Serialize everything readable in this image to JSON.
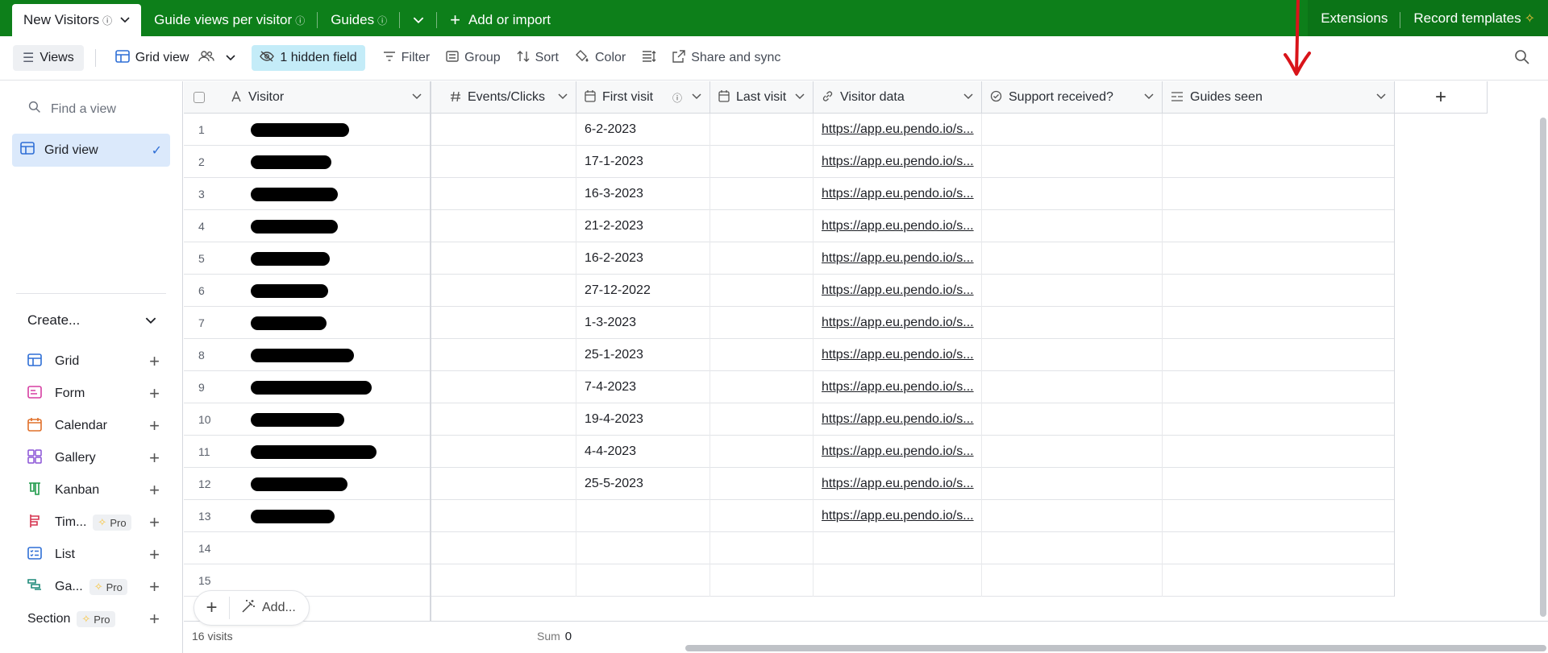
{
  "topbar": {
    "tabs": [
      {
        "label": "New Visitors",
        "active": true
      },
      {
        "label": "Guide views per visitor"
      },
      {
        "label": "Guides"
      }
    ],
    "add_label": "Add or import",
    "extensions_label": "Extensions",
    "record_templates_label": "Record templates"
  },
  "toolbar": {
    "views_label": "Views",
    "grid_view_label": "Grid view",
    "hidden_label": "1 hidden field",
    "filter_label": "Filter",
    "group_label": "Group",
    "sort_label": "Sort",
    "color_label": "Color",
    "share_label": "Share and sync"
  },
  "sidebar": {
    "find_placeholder": "Find a view",
    "active_view": "Grid view",
    "create_label": "Create...",
    "create_items": [
      {
        "label": "Grid",
        "color": "#2f6fd6"
      },
      {
        "label": "Form",
        "color": "#d63ea2"
      },
      {
        "label": "Calendar",
        "color": "#e0702a"
      },
      {
        "label": "Gallery",
        "color": "#8a52d6"
      },
      {
        "label": "Kanban",
        "color": "#1f9a4a"
      },
      {
        "label": "Tim...",
        "color": "#d6334f",
        "pro": "Pro"
      },
      {
        "label": "List",
        "color": "#2f6fd6"
      },
      {
        "label": "Ga...",
        "color": "#1f8a7a",
        "pro": "Pro"
      }
    ],
    "section_label": "Section",
    "section_pro": "Pro"
  },
  "grid": {
    "columns": [
      {
        "label": "Visitor",
        "icon": "text-icon"
      },
      {
        "label": "Events/Clicks",
        "icon": "number-icon"
      },
      {
        "label": "First visit",
        "icon": "calendar-icon"
      },
      {
        "label": "Last visit",
        "icon": "calendar-icon"
      },
      {
        "label": "Visitor data",
        "icon": "link-icon"
      },
      {
        "label": "Support received?",
        "icon": "check-circle-icon"
      },
      {
        "label": "Guides seen",
        "icon": "list-icon"
      }
    ],
    "rows": [
      {
        "n": "1",
        "first": "6-2-2023",
        "url": "https://app.eu.pendo.io/s..."
      },
      {
        "n": "2",
        "first": "17-1-2023",
        "url": "https://app.eu.pendo.io/s..."
      },
      {
        "n": "3",
        "first": "16-3-2023",
        "url": "https://app.eu.pendo.io/s..."
      },
      {
        "n": "4",
        "first": "21-2-2023",
        "url": "https://app.eu.pendo.io/s..."
      },
      {
        "n": "5",
        "first": "16-2-2023",
        "url": "https://app.eu.pendo.io/s..."
      },
      {
        "n": "6",
        "first": "27-12-2022",
        "url": "https://app.eu.pendo.io/s..."
      },
      {
        "n": "7",
        "first": "1-3-2023",
        "url": "https://app.eu.pendo.io/s..."
      },
      {
        "n": "8",
        "first": "25-1-2023",
        "url": "https://app.eu.pendo.io/s..."
      },
      {
        "n": "9",
        "first": "7-4-2023",
        "url": "https://app.eu.pendo.io/s..."
      },
      {
        "n": "10",
        "first": "19-4-2023",
        "url": "https://app.eu.pendo.io/s..."
      },
      {
        "n": "11",
        "first": "4-4-2023",
        "url": "https://app.eu.pendo.io/s..."
      },
      {
        "n": "12",
        "first": "25-5-2023",
        "url": "https://app.eu.pendo.io/s..."
      },
      {
        "n": "13",
        "first": "",
        "url": "https://app.eu.pendo.io/s..."
      },
      {
        "n": "14",
        "first": "",
        "url": ""
      },
      {
        "n": "15",
        "first": "",
        "url": ""
      }
    ],
    "redact_widths": [
      122,
      100,
      108,
      108,
      98,
      96,
      94,
      128,
      150,
      116,
      156,
      120,
      104
    ],
    "add_label": "Add...",
    "footer_count": "16 visits",
    "footer_sum_label": "Sum",
    "footer_sum_value": "0"
  }
}
